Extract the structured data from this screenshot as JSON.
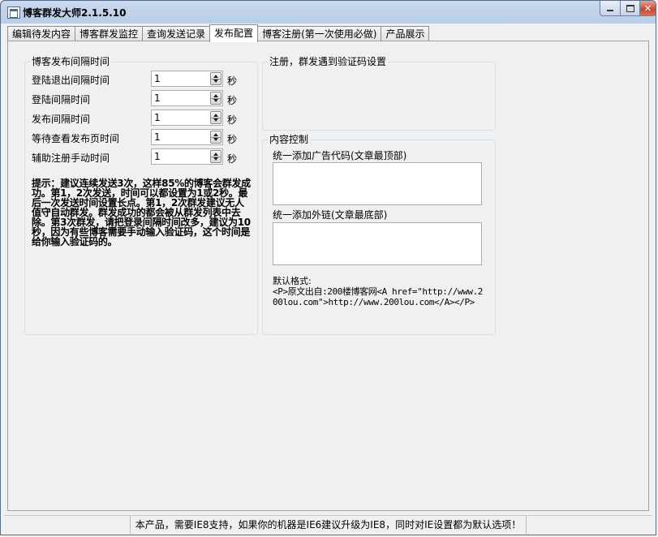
{
  "window": {
    "title": "博客群发大师2.1.5.10"
  },
  "tabs": [
    {
      "label": "编辑待发内容"
    },
    {
      "label": "博客群发监控"
    },
    {
      "label": "查询发送记录"
    },
    {
      "label": "发布配置"
    },
    {
      "label": "博客注册(第一次使用必做)"
    },
    {
      "label": "产品展示"
    }
  ],
  "interval_group": {
    "title": "博客发布间隔时间",
    "unit": "秒",
    "rows": [
      {
        "label": "登陆退出间隔时间",
        "value": "1"
      },
      {
        "label": "登陆间隔时间",
        "value": "1"
      },
      {
        "label": "发布间隔时间",
        "value": "1"
      },
      {
        "label": "等待查看发布页时间",
        "value": "1"
      },
      {
        "label": "辅助注册手动时间",
        "value": "1"
      }
    ],
    "tip": "提示：建议连续发送3次，这样85%的博客会群发成功。第1，2次发送，时间可以都设置为1或2秒。最后一次发送时间设置长点。第1，2次群发建议无人值守自动群发。群发成功的都会被从群发列表中去除。第3次群发，请把登录间隔时间改多，建议为10秒，因为有些博客需要手动输入验证码，这个时间是给你输入验证码的。"
  },
  "captcha_group": {
    "title": "注册，群发遇到验证码设置"
  },
  "content_group": {
    "title": "内容控制",
    "ad_label": "统一添加广告代码(文章最顶部)",
    "link_label": "统一添加外链(文章最底部)",
    "default_format_label": "默认格式:",
    "default_format_text": "<P>原文出自:200楼博客网<A href=\"http://www.200lou.com\">http://www.200lou.com</A></P>"
  },
  "status_bar": {
    "text": "本产品，需要IE8支持，如果你的机器是IE6建议升级为IE8，同时对IE设置都为默认选项！"
  }
}
